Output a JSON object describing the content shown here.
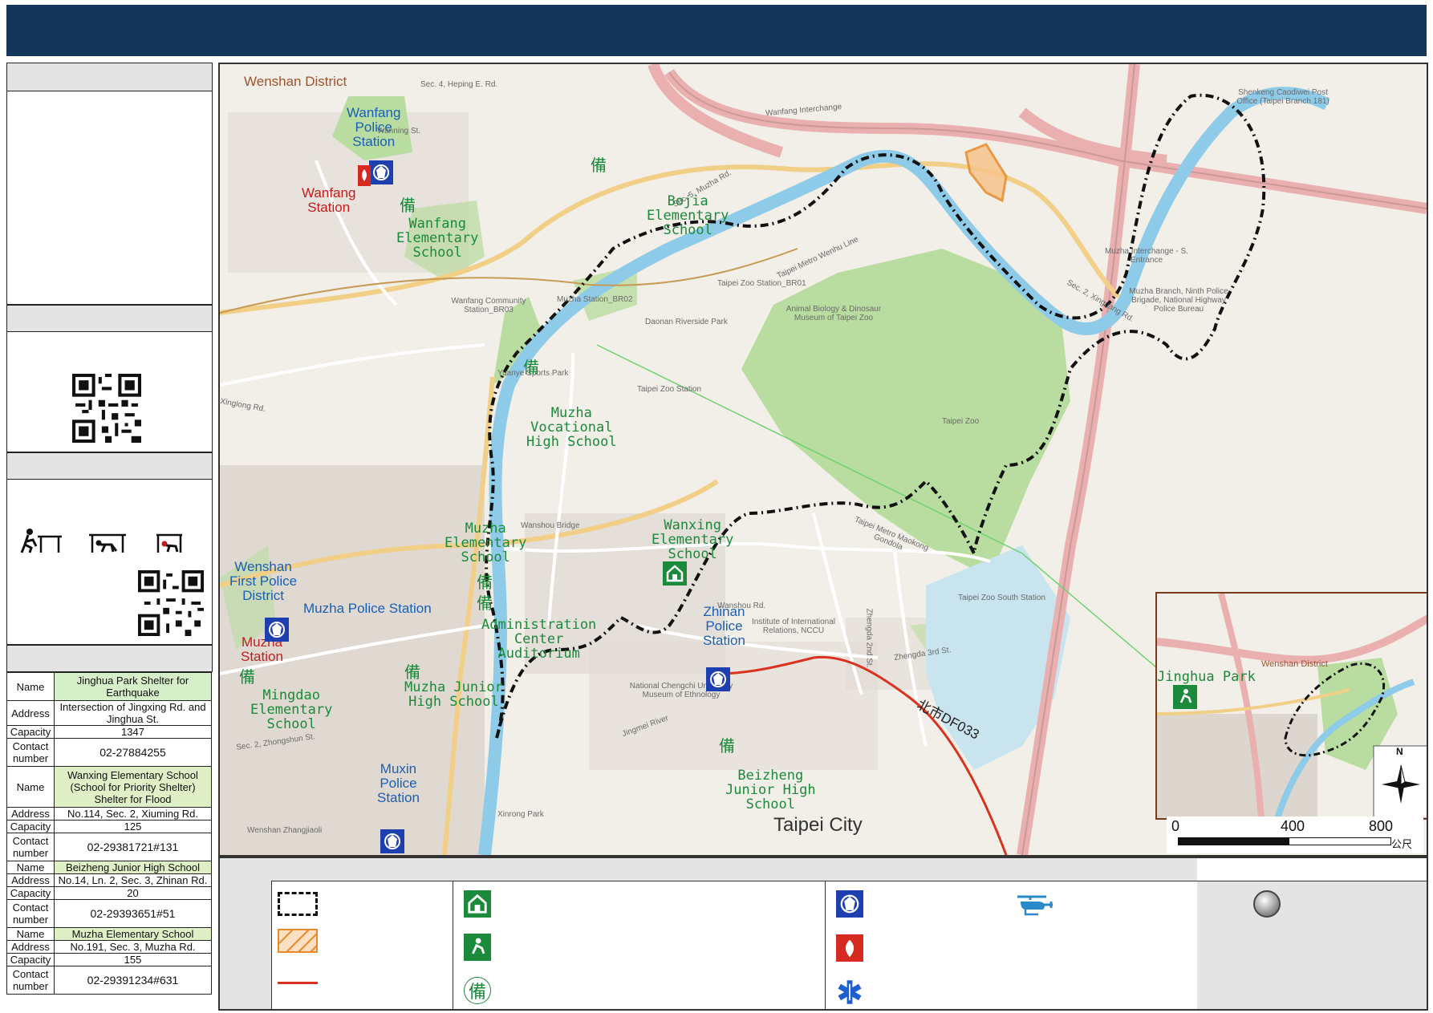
{
  "map": {
    "district_label": "Wenshan District",
    "city_label": "Taipei City",
    "route_label": "北市DF033",
    "inset_district_label": "Wenshan District",
    "inset_park_label": "Jinghua Park",
    "scale": {
      "zero": "0",
      "mid": "400",
      "max": "800",
      "unit": "公尺"
    },
    "compass_letter": "N",
    "facilities": [
      {
        "name": "Wanfang Police Station",
        "lines": [
          "Wanfang",
          "Police",
          "Station"
        ]
      },
      {
        "name": "Wanfang Station",
        "lines": [
          "Wanfang",
          "Station"
        ]
      },
      {
        "name": "Wanfang Elementary School",
        "lines": [
          "Wanfang",
          "Elementary",
          "School"
        ]
      },
      {
        "name": "Bojia Elementary School",
        "lines": [
          "Bojia",
          "Elementary",
          "School"
        ]
      },
      {
        "name": "Muzha Vocational High School",
        "lines": [
          "Muzha",
          "Vocational",
          "High School"
        ]
      },
      {
        "name": "Muzha Elementary School",
        "lines": [
          "Muzha",
          "Elementary",
          "School"
        ]
      },
      {
        "name": "Wanxing Elementary School",
        "lines": [
          "Wanxing",
          "Elementary",
          "School"
        ]
      },
      {
        "name": "Wenshan First Police District",
        "lines": [
          "Wenshan",
          "First Police",
          "District"
        ]
      },
      {
        "name": "Muzha Police Station",
        "lines": [
          "Muzha Police Station"
        ]
      },
      {
        "name": "Muzha Station",
        "lines": [
          "Muzha",
          "Station"
        ]
      },
      {
        "name": "Administration Center Auditorium",
        "lines": [
          "Administration",
          "Center",
          "Auditorium"
        ]
      },
      {
        "name": "Zhinan Police Station",
        "lines": [
          "Zhinan",
          "Police",
          "Station"
        ]
      },
      {
        "name": "Mingdao Elementary School",
        "lines": [
          "Mingdao",
          "Elementary",
          "School"
        ]
      },
      {
        "name": "Muzha Junior High School",
        "lines": [
          "Muzha Junior",
          "High School"
        ]
      },
      {
        "name": "Muxin Police Station",
        "lines": [
          "Muxin",
          "Police",
          "Station"
        ]
      },
      {
        "name": "Beizheng Junior High School",
        "lines": [
          "Beizheng",
          "Junior High",
          "School"
        ]
      }
    ],
    "minor_labels": [
      "Sec. 4, Heping E. Rd.",
      "Wanning St.",
      "Wanfang Interchange",
      "Sec. 5, Muzha Rd.",
      "Taipei Metro Wenhu Line",
      "Taipei Zoo Station_BR01",
      "Animal Biology & Dinosaur Museum of Taipei Zoo",
      "Taipei Zoo",
      "Taipei Metro Maokong Gondola",
      "Taipei Zoo South Station",
      "Muzha Station_BR02",
      "Taipei Zoo Station",
      "Wanshou Bridge",
      "Wanshou Rd.",
      "Zhengda 2nd St.",
      "Zhengda 3rd St.",
      "Institute of International Relations, NCCU",
      "Jingmei River",
      "Sec. 2, Xinguang Rd.",
      "Muzha Interchange - S. Entrance",
      "Muzha Branch, Ninth Police Brigade, National Highway Police Bureau",
      "Shenkeng Caodiwei Post Office (Taipei Branch 181)",
      "Wanfang Community Station_BR03",
      "Daonan Riverside Park",
      "Yuanye Sports Park",
      "Xinglong Rd.",
      "Sec. 2, Zhongshun St.",
      "Wenshan Zhangjiaoli",
      "Xinrong Park",
      "National Chengchi University Museum of Ethnology"
    ]
  },
  "table": {
    "key_name": "Name",
    "key_address": "Address",
    "key_capacity": "Capacity",
    "key_contact": "Contact number",
    "rows": [
      {
        "name": "Jinghua Park Shelter for Earthquake",
        "address": "Intersection of Jingxing Rd. and Jinghua St.",
        "capacity": "1347",
        "contact": "02-27884255"
      },
      {
        "name": "Wanxing Elementary School (School for Priority Shelter) Shelter for Flood",
        "address": "No.114, Sec. 2, Xiuming Rd.",
        "capacity": "125",
        "contact": "02-29381721#131"
      },
      {
        "name": "Beizheng Junior High School",
        "address": "No.14, Ln. 2, Sec. 3, Zhinan Rd.",
        "capacity": "20",
        "contact": "02-29393651#51"
      },
      {
        "name": "Muzha Elementary School",
        "address": "No.191, Sec. 3, Muzha Rd.",
        "capacity": "155",
        "contact": "02-29391234#631"
      }
    ]
  },
  "icons": {
    "police": "police-badge-icon",
    "fire": "fire-station-icon",
    "medical": "medical-star-icon",
    "helicopter": "helicopter-icon",
    "shelter": "shelter-house-icon",
    "park": "park-evacuation-icon",
    "reserve": "reserve-備-icon",
    "compass": "compass-rose-icon",
    "qr": "qr-code-icon",
    "drill": "drop-cover-hold-icon"
  },
  "colors": {
    "header": "#14365a",
    "river": "#8ecbe8",
    "park": "#b9dca0",
    "route": "#d9331f",
    "boundary": "#111111",
    "hazard": "#e88a2a",
    "shelter_green": "#1b8a3a",
    "police_blue": "#1e3fb0"
  }
}
